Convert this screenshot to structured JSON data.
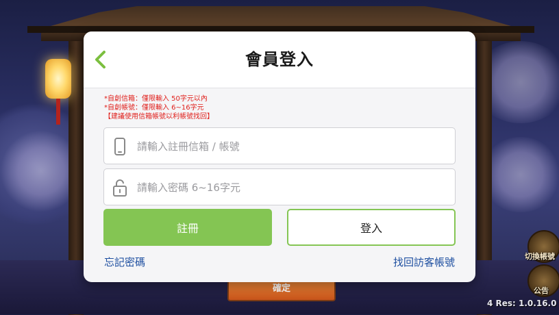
{
  "dialog": {
    "title": "會員登入",
    "notes": [
      "*自創信箱：僅限輸入 50字元以內",
      "*自創帳號：僅限輸入 6~16字元",
      "【建議使用信箱帳號以利帳號找回】"
    ],
    "account_field": {
      "placeholder": "請輸入註冊信箱 / 帳號",
      "value": ""
    },
    "password_field": {
      "placeholder": "請輸入密碼 6~16字元",
      "value": ""
    },
    "register_label": "註冊",
    "login_label": "登入",
    "forgot_password_label": "忘記密碼",
    "recover_guest_label": "找回訪客帳號"
  },
  "background": {
    "confirm_label": "確定",
    "switch_account_label": "切換帳號",
    "notice_label": "公告",
    "version_text": "4 Res: 1.0.16.0"
  },
  "colors": {
    "accent_green": "#84c553",
    "warning_red": "#e0201c",
    "link_blue": "#1e4fa0",
    "back_arrow_green": "#7cbf3f"
  },
  "icons": {
    "back": "chevron-left-icon",
    "account": "phone-icon",
    "password": "lock-icon"
  }
}
